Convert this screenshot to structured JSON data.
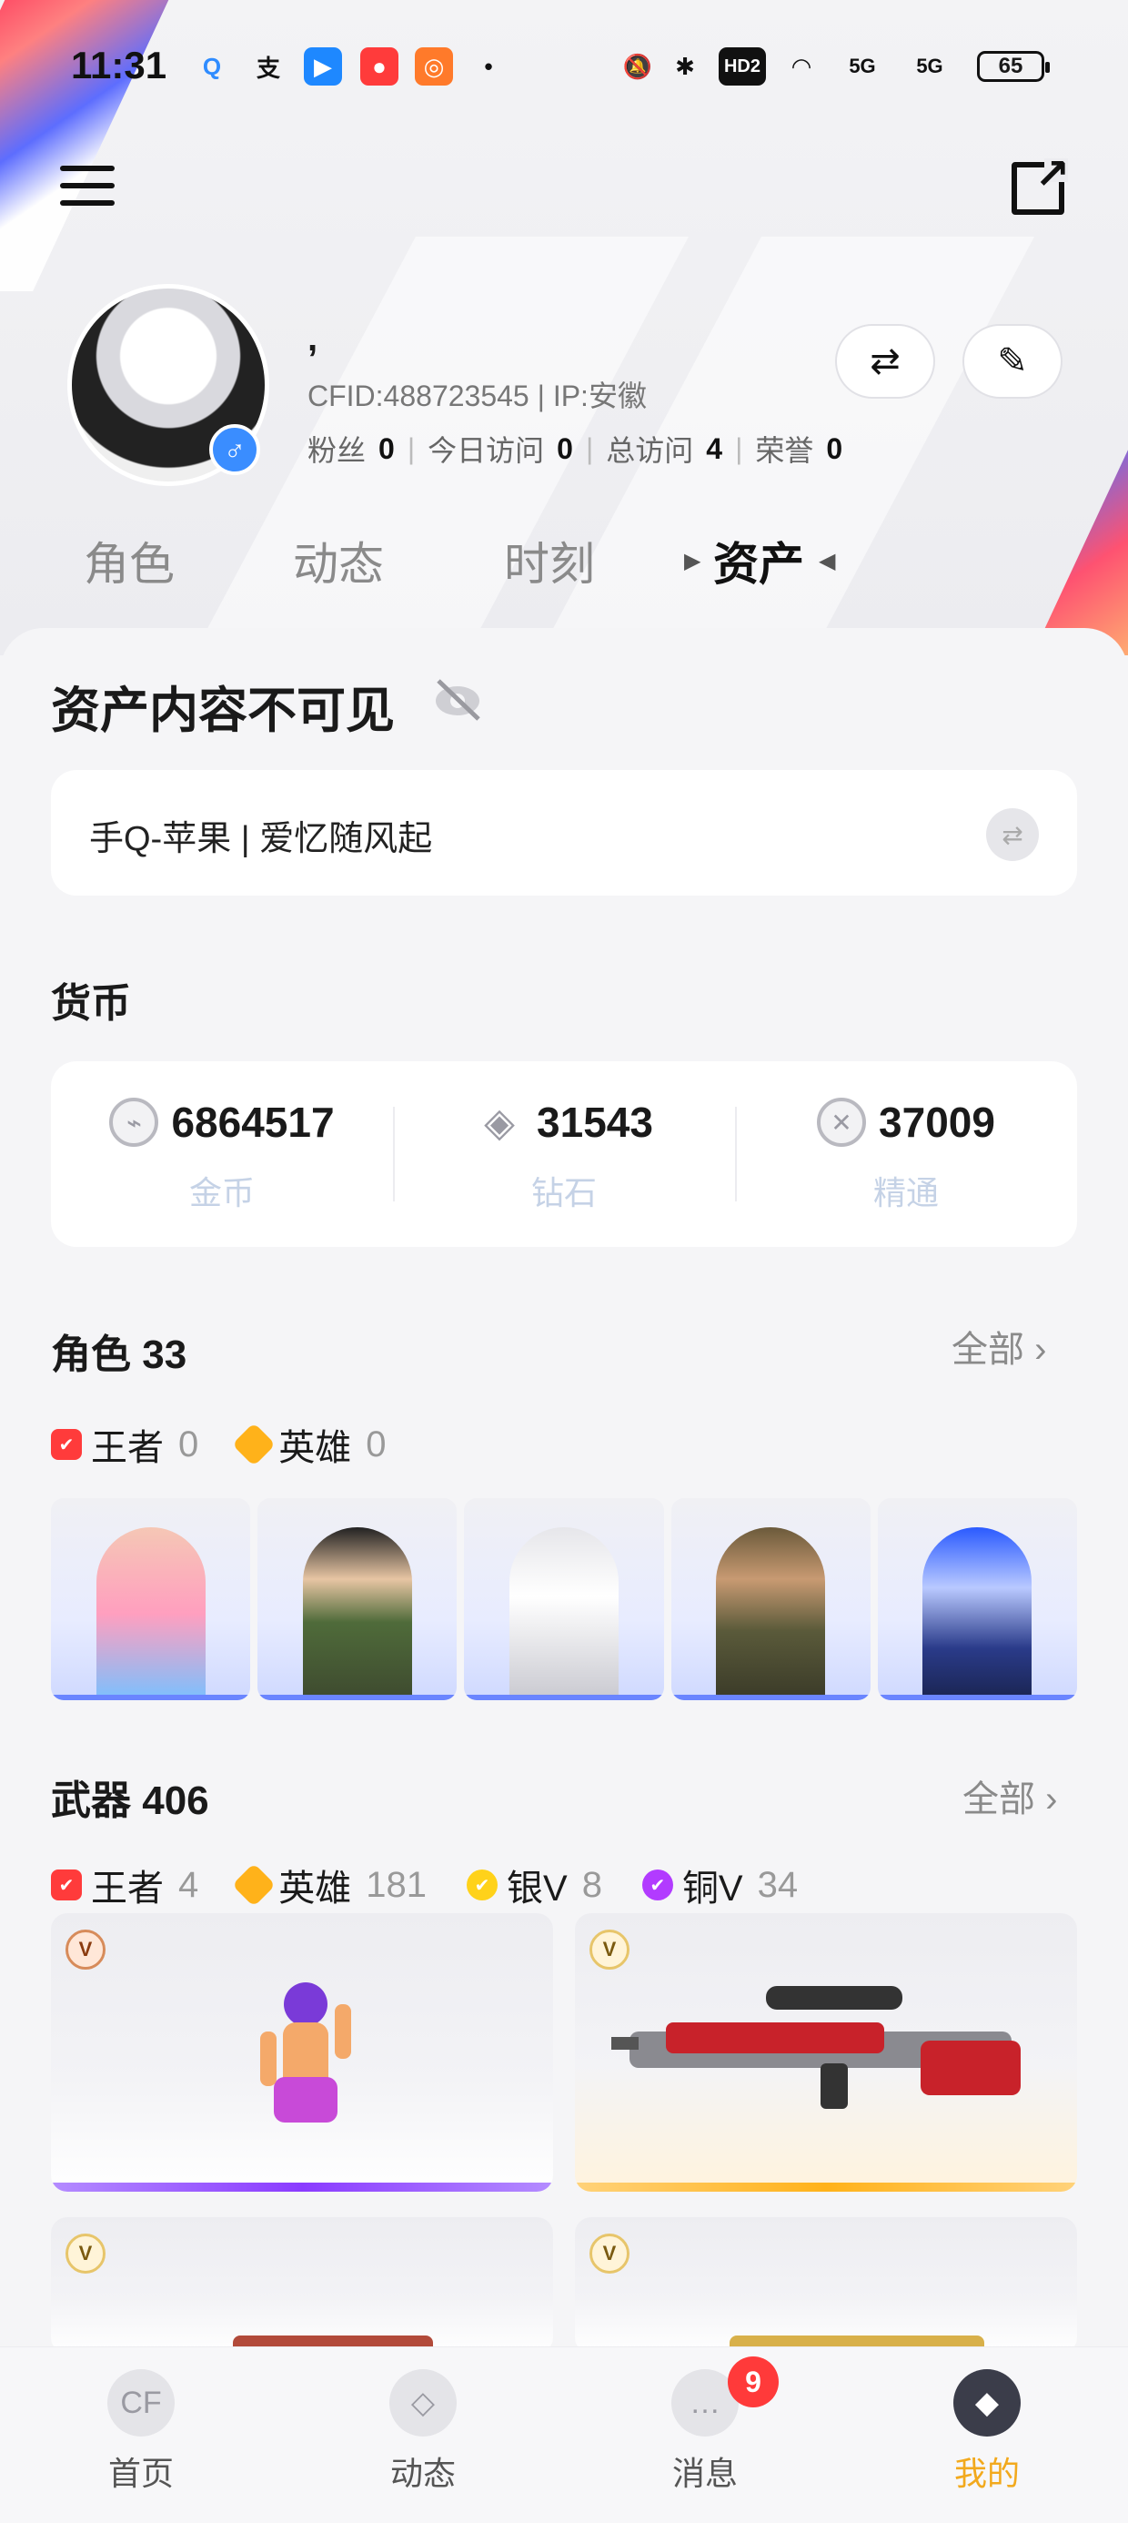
{
  "status_bar": {
    "time": "11:31",
    "battery": "65",
    "icons": [
      "search-icon",
      "alipay-icon",
      "flag-icon",
      "app-icon",
      "app2-icon",
      "dot-icon",
      "mute-icon",
      "bluetooth-icon",
      "hd-icon",
      "wifi-icon",
      "signal-5g-icon",
      "signal-5g-icon"
    ],
    "network_labels": [
      "HD2",
      "5G",
      "5G"
    ]
  },
  "profile": {
    "nickname": ",",
    "cfid_line": "CFID:488723545 | IP:安徽",
    "stats": [
      {
        "label": "粉丝",
        "value": "0"
      },
      {
        "label": "今日访问",
        "value": "0"
      },
      {
        "label": "总访问",
        "value": "4"
      },
      {
        "label": "荣誉",
        "value": "0"
      }
    ],
    "gender": "♂"
  },
  "tabs": [
    "角色",
    "动态",
    "时刻",
    "资产"
  ],
  "assets": {
    "hidden_title": "资产内容不可见",
    "account": "手Q-苹果  |  爱忆随风起",
    "currency_title": "货币",
    "currencies": [
      {
        "value": "6864517",
        "label": "金币",
        "icon": "bullet-icon"
      },
      {
        "value": "31543",
        "label": "钻石",
        "icon": "diamond-icon"
      },
      {
        "value": "37009",
        "label": "精通",
        "icon": "crossed-swords-icon"
      }
    ],
    "roles_title": "角色 33",
    "roles_all": "全部",
    "role_rarity": [
      {
        "label": "王者",
        "count": "0",
        "color": "#ff3b3b"
      },
      {
        "label": "英雄",
        "count": "0",
        "color": "#ffb21a"
      }
    ],
    "weapons_title": "武器 406",
    "weapons_all": "全部",
    "weapon_rarity": [
      {
        "label": "王者",
        "count": "4",
        "color": "#ff3b3b"
      },
      {
        "label": "英雄",
        "count": "181",
        "color": "#ffb21a"
      },
      {
        "label": "银V",
        "count": "8",
        "color": "#ffd21a"
      },
      {
        "label": "铜V",
        "count": "34",
        "color": "#b23bff"
      }
    ]
  },
  "bottom_nav": [
    {
      "label": "首页",
      "icon": "cf-logo-icon"
    },
    {
      "label": "动态",
      "icon": "diamond-nav-icon"
    },
    {
      "label": "消息",
      "icon": "chat-icon",
      "badge": "9"
    },
    {
      "label": "我的",
      "icon": "profile-emblem-icon",
      "active": true
    }
  ],
  "colors": {
    "accent": "#f2a91d",
    "role_bar": "#6a85ff",
    "badge_red": "#ff3a3a"
  }
}
